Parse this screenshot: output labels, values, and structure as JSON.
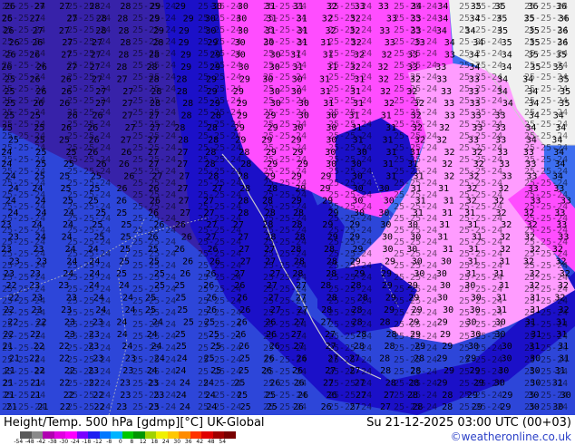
{
  "map": {
    "colors": {
      "ocean_deep": "#1b10c8",
      "purple": "#3722a9",
      "blue": "#2d46d9",
      "light_blue": "#3d6ef0",
      "magenta": "#ff4dff",
      "pink": "#ff9cff",
      "land": "#f0f0f0"
    },
    "contour_label_samples": [
      "36",
      "35",
      "34",
      "33",
      "32",
      "31",
      "30",
      "29",
      "28",
      "27",
      "26",
      "25",
      "24",
      "23",
      "22",
      "21"
    ]
  },
  "footer": {
    "title": "Height/Temp. 500 hPa [gdmp][°C] UK-Global",
    "valid_time": "Su 21-12-2025 03:00 UTC (00+03)",
    "credit": "©weatheronline.co.uk",
    "colorbar_ticks": [
      "-54",
      "-48",
      "-42",
      "-38",
      "-30",
      "-24",
      "-18",
      "-12",
      "-8",
      "0",
      "8",
      "12",
      "18",
      "24",
      "30",
      "36",
      "42",
      "48",
      "54"
    ],
    "colorbar_colors": [
      "#5a5a5a",
      "#8a8a8a",
      "#b000b0",
      "#e000e0",
      "#ff00ff",
      "#7a00ff",
      "#1e1ef0",
      "#0078ff",
      "#00b4ff",
      "#00c800",
      "#009600",
      "#a0d200",
      "#f0f000",
      "#ffc800",
      "#ff8c00",
      "#ff3200",
      "#e00000",
      "#a00000",
      "#780000"
    ]
  }
}
